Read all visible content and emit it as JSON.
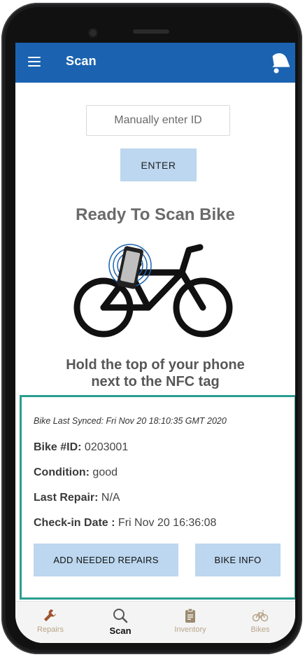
{
  "app": {
    "title": "Scan"
  },
  "scan": {
    "id_placeholder": "Manually enter ID",
    "enter_label": "ENTER",
    "heading": "Ready To Scan Bike",
    "hint_line1": "Hold the top of your phone",
    "hint_line2": "next to the NFC tag"
  },
  "bike": {
    "last_synced": "Bike Last Synced: Fri Nov 20 18:10:35 GMT 2020",
    "id_label": "Bike #ID:",
    "id_value": "0203001",
    "condition_label": "Condition:",
    "condition_value": "good",
    "last_repair_label": "Last Repair:",
    "last_repair_value": "N/A",
    "checkin_label": "Check-in Date :",
    "checkin_value": "Fri Nov 20 16:36:08",
    "add_repairs_label": "ADD NEEDED REPAIRS",
    "bike_info_label": "BIKE INFO"
  },
  "tabs": [
    {
      "label": "Repairs",
      "icon": "wrench-icon"
    },
    {
      "label": "Scan",
      "icon": "search-icon",
      "active": true
    },
    {
      "label": "Inventory",
      "icon": "clipboard-icon"
    },
    {
      "label": "Bikes",
      "icon": "bicycle-icon"
    }
  ],
  "colors": {
    "appbar": "#1b63b1",
    "button": "#bcd7ef",
    "card_border": "#2a9d8f",
    "tab_inactive": "#b9a58a"
  }
}
